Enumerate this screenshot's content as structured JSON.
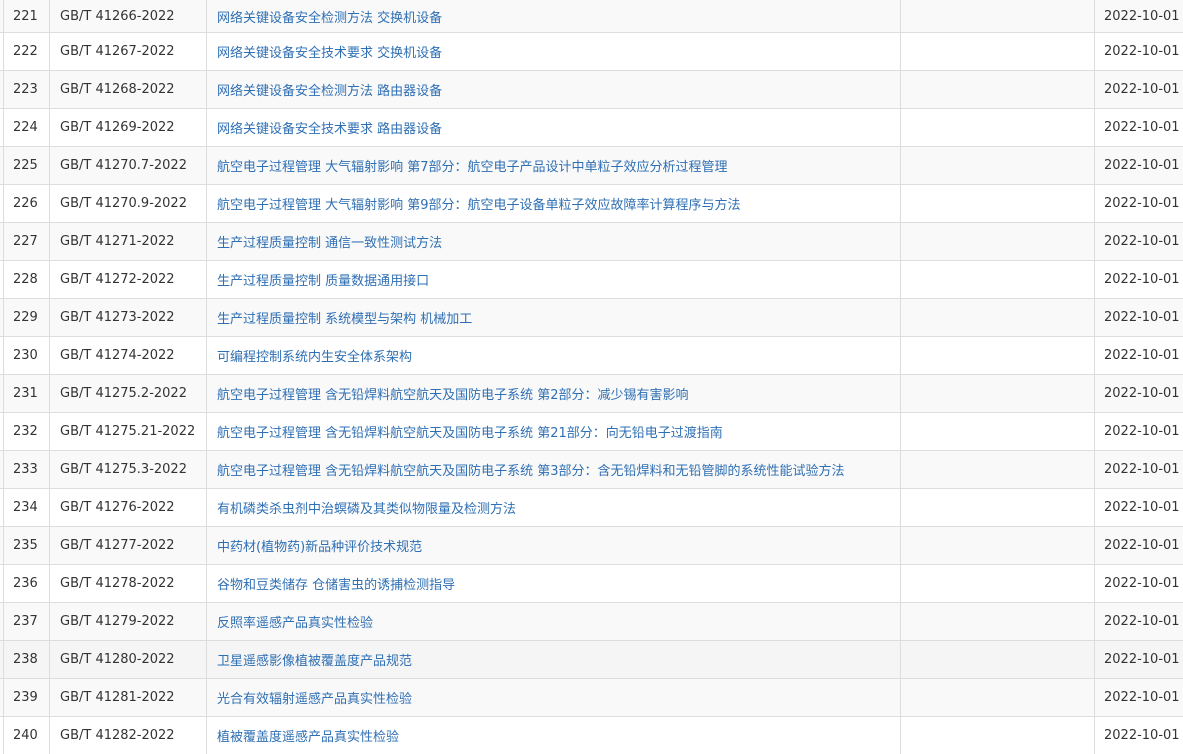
{
  "rows": [
    {
      "idx": "221",
      "code": "GB/T 41266-2022",
      "name": "网络关键设备安全检测方法 交换机设备",
      "date": "2022-10-01"
    },
    {
      "idx": "222",
      "code": "GB/T 41267-2022",
      "name": "网络关键设备安全技术要求 交换机设备",
      "date": "2022-10-01"
    },
    {
      "idx": "223",
      "code": "GB/T 41268-2022",
      "name": "网络关键设备安全检测方法 路由器设备",
      "date": "2022-10-01"
    },
    {
      "idx": "224",
      "code": "GB/T 41269-2022",
      "name": "网络关键设备安全技术要求 路由器设备",
      "date": "2022-10-01"
    },
    {
      "idx": "225",
      "code": "GB/T 41270.7-2022",
      "name": "航空电子过程管理 大气辐射影响 第7部分：航空电子产品设计中单粒子效应分析过程管理",
      "date": "2022-10-01"
    },
    {
      "idx": "226",
      "code": "GB/T 41270.9-2022",
      "name": "航空电子过程管理 大气辐射影响 第9部分：航空电子设备单粒子效应故障率计算程序与方法",
      "date": "2022-10-01"
    },
    {
      "idx": "227",
      "code": "GB/T 41271-2022",
      "name": "生产过程质量控制 通信一致性测试方法",
      "date": "2022-10-01"
    },
    {
      "idx": "228",
      "code": "GB/T 41272-2022",
      "name": "生产过程质量控制 质量数据通用接口",
      "date": "2022-10-01"
    },
    {
      "idx": "229",
      "code": "GB/T 41273-2022",
      "name": "生产过程质量控制 系统模型与架构 机械加工",
      "date": "2022-10-01"
    },
    {
      "idx": "230",
      "code": "GB/T 41274-2022",
      "name": "可编程控制系统内生安全体系架构",
      "date": "2022-10-01"
    },
    {
      "idx": "231",
      "code": "GB/T 41275.2-2022",
      "name": "航空电子过程管理 含无铅焊料航空航天及国防电子系统 第2部分：减少锡有害影响",
      "date": "2022-10-01"
    },
    {
      "idx": "232",
      "code": "GB/T 41275.21-2022",
      "name": "航空电子过程管理 含无铅焊料航空航天及国防电子系统 第21部分：向无铅电子过渡指南",
      "date": "2022-10-01"
    },
    {
      "idx": "233",
      "code": "GB/T 41275.3-2022",
      "name": "航空电子过程管理 含无铅焊料航空航天及国防电子系统 第3部分：含无铅焊料和无铅管脚的系统性能试验方法",
      "date": "2022-10-01"
    },
    {
      "idx": "234",
      "code": "GB/T 41276-2022",
      "name": "有机磷类杀虫剂中治螟磷及其类似物限量及检测方法",
      "date": "2022-10-01"
    },
    {
      "idx": "235",
      "code": "GB/T 41277-2022",
      "name": "中药材(植物药)新品种评价技术规范",
      "date": "2022-10-01"
    },
    {
      "idx": "236",
      "code": "GB/T 41278-2022",
      "name": "谷物和豆类储存 仓储害虫的诱捕检测指导",
      "date": "2022-10-01"
    },
    {
      "idx": "237",
      "code": "GB/T 41279-2022",
      "name": "反照率遥感产品真实性检验",
      "date": "2022-10-01"
    },
    {
      "idx": "238",
      "code": "GB/T 41280-2022",
      "name": "卫星遥感影像植被覆盖度产品规范",
      "date": "2022-10-01"
    },
    {
      "idx": "239",
      "code": "GB/T 41281-2022",
      "name": "光合有效辐射遥感产品真实性检验",
      "date": "2022-10-01"
    },
    {
      "idx": "240",
      "code": "GB/T 41282-2022",
      "name": "植被覆盖度遥感产品真实性检验",
      "date": "2022-10-01"
    }
  ]
}
